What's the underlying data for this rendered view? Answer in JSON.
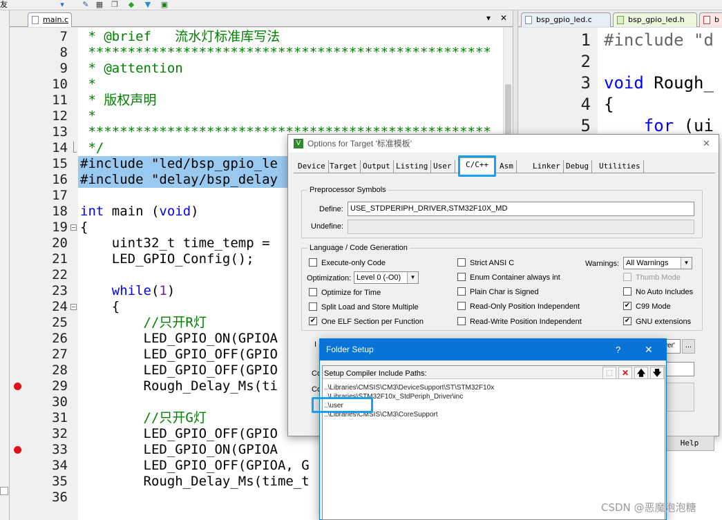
{
  "toolbar": {
    "menu_glyph": "友"
  },
  "editor1": {
    "tab_label": "main.c",
    "tab_menu_glyph": "▾",
    "tab_close_glyph": "✕",
    "lines": [
      {
        "n": "7",
        "segs": [
          {
            "t": " * @brief   流水灯标准库写法",
            "c": "g"
          }
        ]
      },
      {
        "n": "8",
        "segs": [
          {
            "t": " ***************************************************",
            "c": "g"
          }
        ]
      },
      {
        "n": "9",
        "segs": [
          {
            "t": " * @attention",
            "c": "g"
          }
        ]
      },
      {
        "n": "10",
        "segs": [
          {
            "t": " *",
            "c": "g"
          }
        ]
      },
      {
        "n": "11",
        "segs": [
          {
            "t": " * 版权声明",
            "c": "g"
          }
        ]
      },
      {
        "n": "12",
        "segs": [
          {
            "t": " *",
            "c": "g"
          }
        ]
      },
      {
        "n": "13",
        "segs": [
          {
            "t": " ***************************************************",
            "c": "g"
          }
        ]
      },
      {
        "n": "14",
        "segs": [
          {
            "t": " */",
            "c": "g"
          }
        ]
      },
      {
        "n": "15",
        "segs": [
          {
            "t": "#include \"led/bsp_gpio_le",
            "c": ""
          }
        ]
      },
      {
        "n": "16",
        "segs": [
          {
            "t": "#include \"delay/bsp_delay",
            "c": ""
          }
        ]
      },
      {
        "n": "17",
        "segs": []
      },
      {
        "n": "18",
        "segs": [
          {
            "t": "int",
            "c": "b"
          },
          {
            "t": " main (",
            "c": ""
          },
          {
            "t": "void",
            "c": "b"
          },
          {
            "t": ")",
            "c": ""
          }
        ]
      },
      {
        "n": "19",
        "segs": [
          {
            "t": "{",
            "c": ""
          }
        ]
      },
      {
        "n": "20",
        "segs": [
          {
            "t": "    uint32_t time_temp =",
            "c": ""
          }
        ]
      },
      {
        "n": "21",
        "segs": [
          {
            "t": "    LED_GPIO_Config();",
            "c": ""
          }
        ]
      },
      {
        "n": "22",
        "segs": []
      },
      {
        "n": "23",
        "segs": [
          {
            "t": "    ",
            "c": ""
          },
          {
            "t": "while",
            "c": "b"
          },
          {
            "t": "(",
            "c": ""
          },
          {
            "t": "1",
            "c": "p"
          },
          {
            "t": ")",
            "c": ""
          }
        ]
      },
      {
        "n": "24",
        "segs": [
          {
            "t": "    {",
            "c": ""
          }
        ]
      },
      {
        "n": "25",
        "segs": [
          {
            "t": "        //只开R灯",
            "c": "g"
          }
        ]
      },
      {
        "n": "26",
        "segs": [
          {
            "t": "        LED_GPIO_ON(GPIOA",
            "c": ""
          }
        ]
      },
      {
        "n": "27",
        "segs": [
          {
            "t": "        LED_GPIO_OFF(GPIO",
            "c": ""
          }
        ]
      },
      {
        "n": "28",
        "segs": [
          {
            "t": "        LED_GPIO_OFF(GPIO",
            "c": ""
          }
        ]
      },
      {
        "n": "29",
        "segs": [
          {
            "t": "        Rough_Delay_Ms(ti",
            "c": ""
          }
        ]
      },
      {
        "n": "30",
        "segs": []
      },
      {
        "n": "31",
        "segs": [
          {
            "t": "        //只开G灯",
            "c": "g"
          }
        ]
      },
      {
        "n": "32",
        "segs": [
          {
            "t": "        LED_GPIO_OFF(GPIO",
            "c": ""
          }
        ]
      },
      {
        "n": "33",
        "segs": [
          {
            "t": "        LED_GPIO_ON(GPIOA",
            "c": ""
          }
        ]
      },
      {
        "n": "34",
        "segs": [
          {
            "t": "        LED_GPIO_OFF(GPIOA, G",
            "c": ""
          }
        ]
      },
      {
        "n": "35",
        "segs": [
          {
            "t": "        Rough_Delay_Ms(time_t",
            "c": ""
          }
        ]
      },
      {
        "n": "36",
        "segs": []
      }
    ]
  },
  "editor2": {
    "tabs": [
      "bsp_gpio_led.c",
      "bsp_gpio_led.h",
      "b"
    ],
    "lines": [
      {
        "n": "1",
        "segs": [
          {
            "t": "#include \"d",
            "c": "gr"
          }
        ]
      },
      {
        "n": "2",
        "segs": []
      },
      {
        "n": "3",
        "segs": [
          {
            "t": "void",
            "c": "b"
          },
          {
            "t": " Rough_",
            "c": ""
          }
        ]
      },
      {
        "n": "4",
        "segs": [
          {
            "t": "{",
            "c": ""
          }
        ]
      },
      {
        "n": "5",
        "segs": [
          {
            "t": "    ",
            "c": ""
          },
          {
            "t": "for",
            "c": "b"
          },
          {
            "t": " (ui",
            "c": ""
          }
        ]
      }
    ]
  },
  "options": {
    "title": "Options for Target '标准模板'",
    "close_glyph": "✕",
    "tabs": [
      "Device",
      "Target",
      "Output",
      "Listing",
      "User",
      "C/C++",
      "Asm",
      "Linker",
      "Debug",
      "Utilities"
    ],
    "active_tab": "C/C++",
    "preprocessor": {
      "group_label": "Preprocessor Symbols",
      "define_label": "Define:",
      "define_value": "USE_STDPERIPH_DRIVER,STM32F10X_MD",
      "undefine_label": "Undefine:",
      "undefine_value": ""
    },
    "lang": {
      "group_label": "Language / Code Generation",
      "execute_only": "Execute-only Code",
      "optimization_label": "Optimization:",
      "optimization_value": "Level 0 (-O0)",
      "optimize_time": "Optimize for Time",
      "split_load": "Split Load and Store Multiple",
      "one_elf": "One ELF Section per Function",
      "strict_ansi": "Strict ANSI C",
      "enum_container": "Enum Container always int",
      "plain_char": "Plain Char is Signed",
      "ro_pos": "Read-Only Position Independent",
      "rw_pos": "Read-Write Position Independent",
      "warnings_label": "Warnings:",
      "warnings_value": "All Warnings",
      "thumb_mode": "Thumb Mode",
      "no_auto": "No Auto Includes",
      "c99": "C99 Mode",
      "gnu_ext": "GNU extensions"
    },
    "checks": {
      "execute_only": false,
      "optimize_time": false,
      "split_load": false,
      "one_elf": true,
      "strict_ansi": false,
      "enum_container": false,
      "plain_char": false,
      "ro_pos": false,
      "rw_pos": false,
      "thumb_mode": false,
      "no_auto": false,
      "c99": true,
      "gnu_ext": true
    },
    "peek": {
      "include_label": "I",
      "include_value": "ver'",
      "browse_label": "...",
      "misc_label": "Co",
      "cmd_label": "Co"
    },
    "help_label": "Help"
  },
  "folder_setup": {
    "title": "Folder Setup",
    "help_glyph": "?",
    "close_glyph": "✕",
    "header_label": "Setup Compiler Include Paths:",
    "buttons": [
      "new-icon",
      "delete-icon",
      "move-up-icon",
      "move-down-icon"
    ],
    "button_glyphs": [
      "⬚",
      "✕",
      "🡅",
      "🡇"
    ],
    "paths": [
      "..\\Libraries\\CMSIS\\CM3\\DeviceSupport\\ST\\STM32F10x",
      "..\\Libraries\\STM32F10x_StdPeriph_Driver\\inc",
      "..\\user",
      "..\\Libraries\\CMSIS\\CM3\\CoreSupport"
    ]
  },
  "watermark": "CSDN @恶魔泡泡糖",
  "colors": {
    "highlight_box": "#16a0ee",
    "selection": "#99c9ef",
    "comment": "#008000",
    "keyword": "#0000ff",
    "breakpoint": "#e0101a",
    "titlebar": "#0a74d6"
  }
}
